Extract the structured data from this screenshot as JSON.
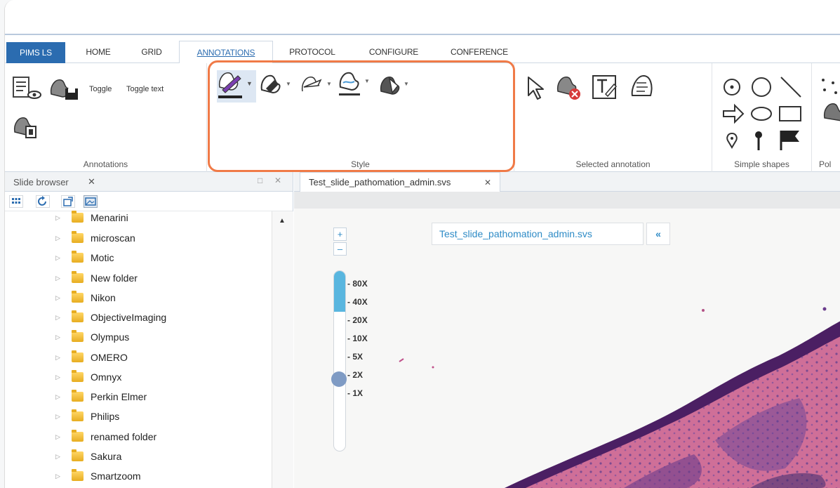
{
  "tabs": [
    {
      "label": "PIMS LS"
    },
    {
      "label": "HOME"
    },
    {
      "label": "GRID"
    },
    {
      "label": "ANNOTATIONS",
      "active": true
    },
    {
      "label": "PROTOCOL"
    },
    {
      "label": "CONFIGURE"
    },
    {
      "label": "CONFERENCE"
    }
  ],
  "ribbon": {
    "annotations": {
      "label": "Annotations",
      "toggle": "Toggle",
      "toggle_text": "Toggle text"
    },
    "style": {
      "label": "Style"
    },
    "selected": {
      "label": "Selected annotation"
    },
    "simple_shapes": {
      "label": "Simple shapes"
    },
    "next_group_partial": {
      "label": "Pol"
    }
  },
  "highlight_color": "#f07a47",
  "slide_browser": {
    "title": "Slide browser",
    "folders": [
      "Menarini",
      "microscan",
      "Motic",
      "New folder",
      "Nikon",
      "ObjectiveImaging",
      "Olympus",
      "OMERO",
      "Omnyx",
      "Perkin Elmer",
      "Philips",
      "renamed folder",
      "Sakura",
      "Smartzoom"
    ]
  },
  "viewer": {
    "tab_title": "Test_slide_pathomation_admin.svs",
    "slide_name": "Test_slide_pathomation_admin.svs",
    "collapse_label": "«",
    "zoom_in": "+",
    "zoom_out": "–",
    "zoom_levels": [
      "80X",
      "40X",
      "20X",
      "10X",
      "5X",
      "2X",
      "1X"
    ],
    "current_zoom": "2X"
  },
  "colors": {
    "accent": "#2b6cb0",
    "link": "#2e8bc6",
    "zoom_fill": "#59b6df",
    "folder": "#f0c040"
  }
}
